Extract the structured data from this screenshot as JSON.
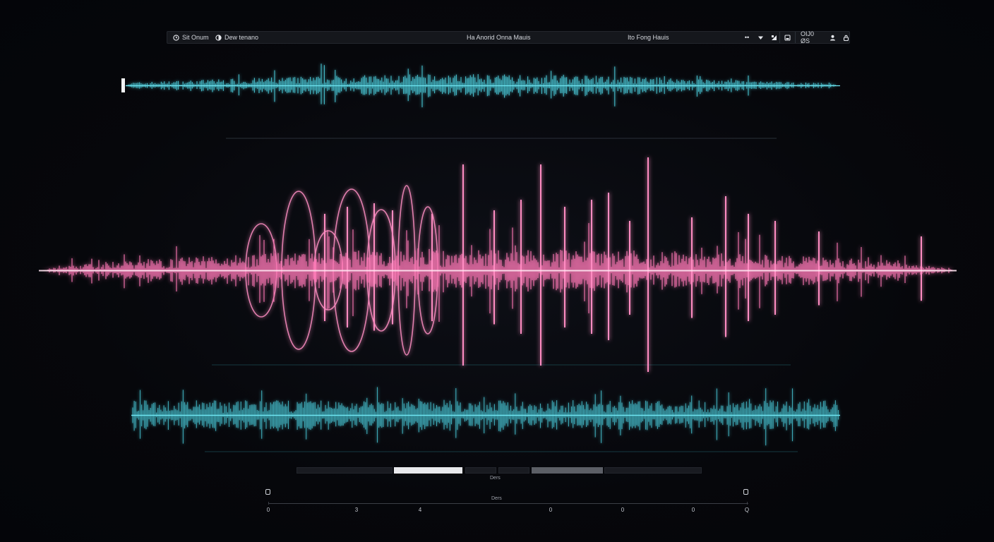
{
  "topbar": {
    "left_1": "Sit Onum",
    "left_2": "Dew tenano",
    "center": "Ha Anorid Onna Mauis",
    "right_label": "Ito Fong Hauis",
    "right_2": "OIJ0 ØS",
    "icons": [
      "clock-icon",
      "half-circle-icon",
      "dots-icon",
      "dropdown-icon",
      "signal-icon",
      "save-icon",
      "user-icon",
      "lock-icon"
    ]
  },
  "transport": {
    "label": "Ders"
  },
  "timeline": {
    "label": "Ders",
    "ticks": [
      "0",
      "3",
      "4",
      "0",
      "0",
      "0",
      "Q"
    ]
  },
  "colors": {
    "accent_teal": "#4fd7e6",
    "accent_pink": "#ff6fb0",
    "background": "#06070b"
  }
}
